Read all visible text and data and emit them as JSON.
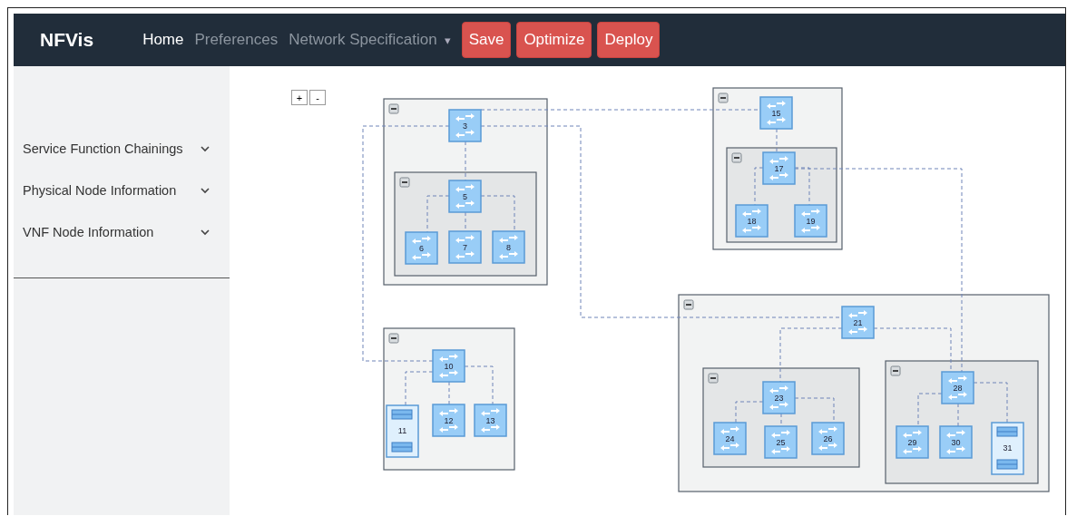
{
  "navbar": {
    "brand": "NFVis",
    "links": [
      {
        "label": "Home",
        "selected": true
      },
      {
        "label": "Preferences",
        "selected": false
      }
    ],
    "dropdown": {
      "label": "Network Specification",
      "caret": "▾"
    },
    "buttons": [
      "Save",
      "Optimize",
      "Deploy"
    ]
  },
  "sidebar": {
    "items": [
      {
        "label": "Service Function Chainings",
        "expanded": false
      },
      {
        "label": "Physical Node Information",
        "expanded": false
      },
      {
        "label": "VNF Node Information",
        "expanded": false
      }
    ]
  },
  "diagram": {
    "zoom_buttons": [
      "+",
      "-"
    ],
    "groups": [
      {
        "expanded": true,
        "nodes": [
          {
            "label": "3",
            "kind": "switch"
          }
        ],
        "groups": [
          {
            "expanded": true,
            "nodes": [
              {
                "label": "5",
                "kind": "switch"
              },
              {
                "label": "6",
                "kind": "switch"
              },
              {
                "label": "7",
                "kind": "switch"
              },
              {
                "label": "8",
                "kind": "switch"
              }
            ]
          }
        ]
      },
      {
        "expanded": true,
        "nodes": [
          {
            "label": "15",
            "kind": "switch"
          }
        ],
        "groups": [
          {
            "expanded": true,
            "nodes": [
              {
                "label": "17",
                "kind": "switch"
              },
              {
                "label": "18",
                "kind": "switch"
              },
              {
                "label": "19",
                "kind": "switch"
              }
            ]
          }
        ]
      },
      {
        "expanded": true,
        "nodes": [
          {
            "label": "10",
            "kind": "switch"
          },
          {
            "label": "11",
            "kind": "server"
          },
          {
            "label": "12",
            "kind": "switch"
          },
          {
            "label": "13",
            "kind": "switch"
          }
        ]
      },
      {
        "expanded": true,
        "nodes": [
          {
            "label": "21",
            "kind": "switch"
          }
        ],
        "groups": [
          {
            "expanded": true,
            "nodes": [
              {
                "label": "23",
                "kind": "switch"
              },
              {
                "label": "24",
                "kind": "switch"
              },
              {
                "label": "25",
                "kind": "switch"
              },
              {
                "label": "26",
                "kind": "switch"
              }
            ]
          },
          {
            "expanded": true,
            "nodes": [
              {
                "label": "28",
                "kind": "switch"
              },
              {
                "label": "29",
                "kind": "switch"
              },
              {
                "label": "30",
                "kind": "switch"
              },
              {
                "label": "31",
                "kind": "server"
              }
            ]
          }
        ]
      }
    ]
  }
}
